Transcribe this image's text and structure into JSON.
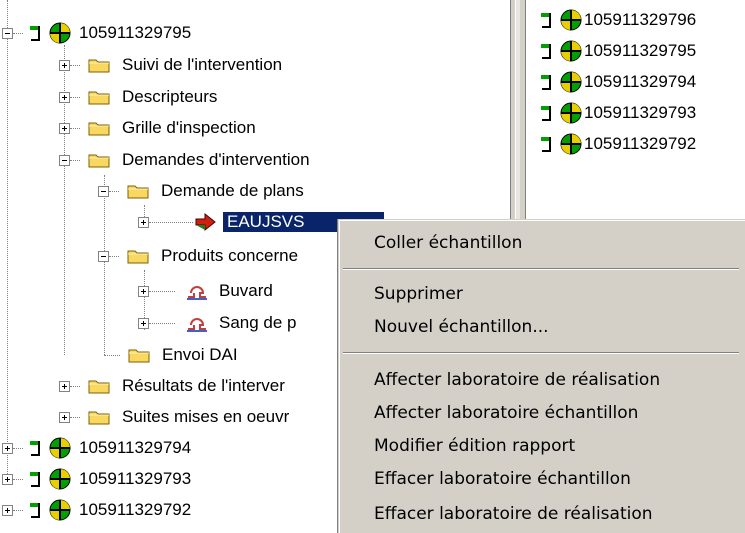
{
  "tree": {
    "root_id": "105911329795",
    "children": [
      {
        "label": "Suivi de l'intervention"
      },
      {
        "label": "Descripteurs"
      },
      {
        "label": "Grille d'inspection"
      },
      {
        "label": "Demandes d'intervention"
      },
      {
        "label": "Demande de plans"
      },
      {
        "label": "EAUJSVS"
      },
      {
        "label": "Produits concerne"
      },
      {
        "label": "Buvard"
      },
      {
        "label": "Sang de p"
      },
      {
        "label": "Envoi DAI"
      },
      {
        "label": "Résultats de l'interver"
      },
      {
        "label": "Suites mises en oeuvr"
      }
    ],
    "siblings": [
      "105911329794",
      "105911329793",
      "105911329792"
    ]
  },
  "right_list": [
    "105911329796",
    "105911329795",
    "105911329794",
    "105911329793",
    "105911329792"
  ],
  "context_menu": {
    "items": [
      "Coller échantillon",
      "Supprimer",
      "Nouvel échantillon...",
      "Affecter laboratoire de réalisation",
      "Affecter laboratoire échantillon",
      "Modifier édition rapport",
      "Effacer laboratoire échantillon",
      "Effacer laboratoire de réalisation"
    ]
  },
  "colors": {
    "selection": "#0a246a",
    "menu_bg": "#d4d0c8",
    "folder": "#f8d860"
  }
}
